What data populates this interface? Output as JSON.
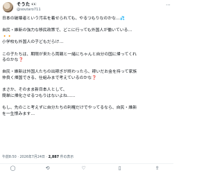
{
  "header": {
    "display_name": "そうた 👀",
    "handle": "@soutaro711",
    "more_icon": "more-icon"
  },
  "tweet": {
    "lines": [
      "日本の破壊者という汚名を着せられても、やるつもりなのかな…",
      "",
      "自民・維新の強力な移民政策で、どこに行っても外国人が働いている…",
      "",
      "小学校も外国人の子どもだらけ…",
      "",
      "この子たちは、期限が来たら両親と一緒にちゃんと自分の国に帰ってくれ",
      "るのかな❓",
      "",
      "自民・維新は外国人たちの出稼ぎが終わったら、稼いだお金を持って家族",
      "仲良く帰国できる、仕組みまで考えているのかな❓",
      "",
      "まさか、そのまま新日本人として、",
      "簡単に帰化させるつもりはないよね……",
      "",
      "もし、先のこと考えずに自分たちの利権だけでやってるなら、自民・維新",
      "を一生恨みます…"
    ],
    "line1_emoji": "💦",
    "line3_emoji": "🔸🔸"
  },
  "meta": {
    "time": "午前8:50",
    "date": "2026年7月24日",
    "views": "2,887",
    "views_label": "件の表示"
  },
  "actions": [
    {
      "name": "reply-icon",
      "glyph": "◯"
    },
    {
      "name": "retweet-icon",
      "glyph": "⟲"
    },
    {
      "name": "like-icon",
      "glyph": "♡"
    },
    {
      "name": "bookmark-icon",
      "glyph": "▯"
    },
    {
      "name": "share-icon",
      "glyph": "⇪"
    }
  ]
}
